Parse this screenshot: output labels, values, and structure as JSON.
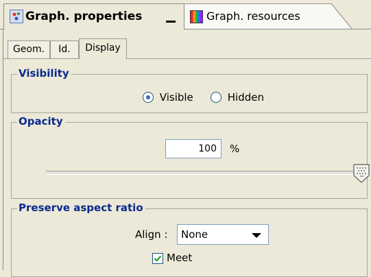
{
  "top_tabs": [
    {
      "label": "Graph. properties",
      "icon": "graph-properties-icon",
      "active": true
    },
    {
      "label": "Graph. resources",
      "icon": "graph-resources-icon",
      "active": false
    }
  ],
  "sub_tabs": [
    {
      "label": "Geom."
    },
    {
      "label": "Id."
    },
    {
      "label": "Display"
    }
  ],
  "active_sub_tab": "Display",
  "visibility": {
    "title": "Visibility",
    "options": [
      {
        "label": "Visible",
        "checked": true
      },
      {
        "label": "Hidden",
        "checked": false
      }
    ]
  },
  "opacity": {
    "title": "Opacity",
    "value": "100",
    "unit": "%",
    "slider_level": 1.0
  },
  "preserve_aspect_ratio": {
    "title": "Preserve aspect ratio",
    "align_label": "Align :",
    "align_value": "None",
    "meet_label": "Meet",
    "meet_checked": true
  },
  "colors": {
    "legend_text": "#0b2a8f",
    "panel_bg": "#ece9d8",
    "input_border": "#7f9db9",
    "radio_dot": "#3a66c7"
  }
}
